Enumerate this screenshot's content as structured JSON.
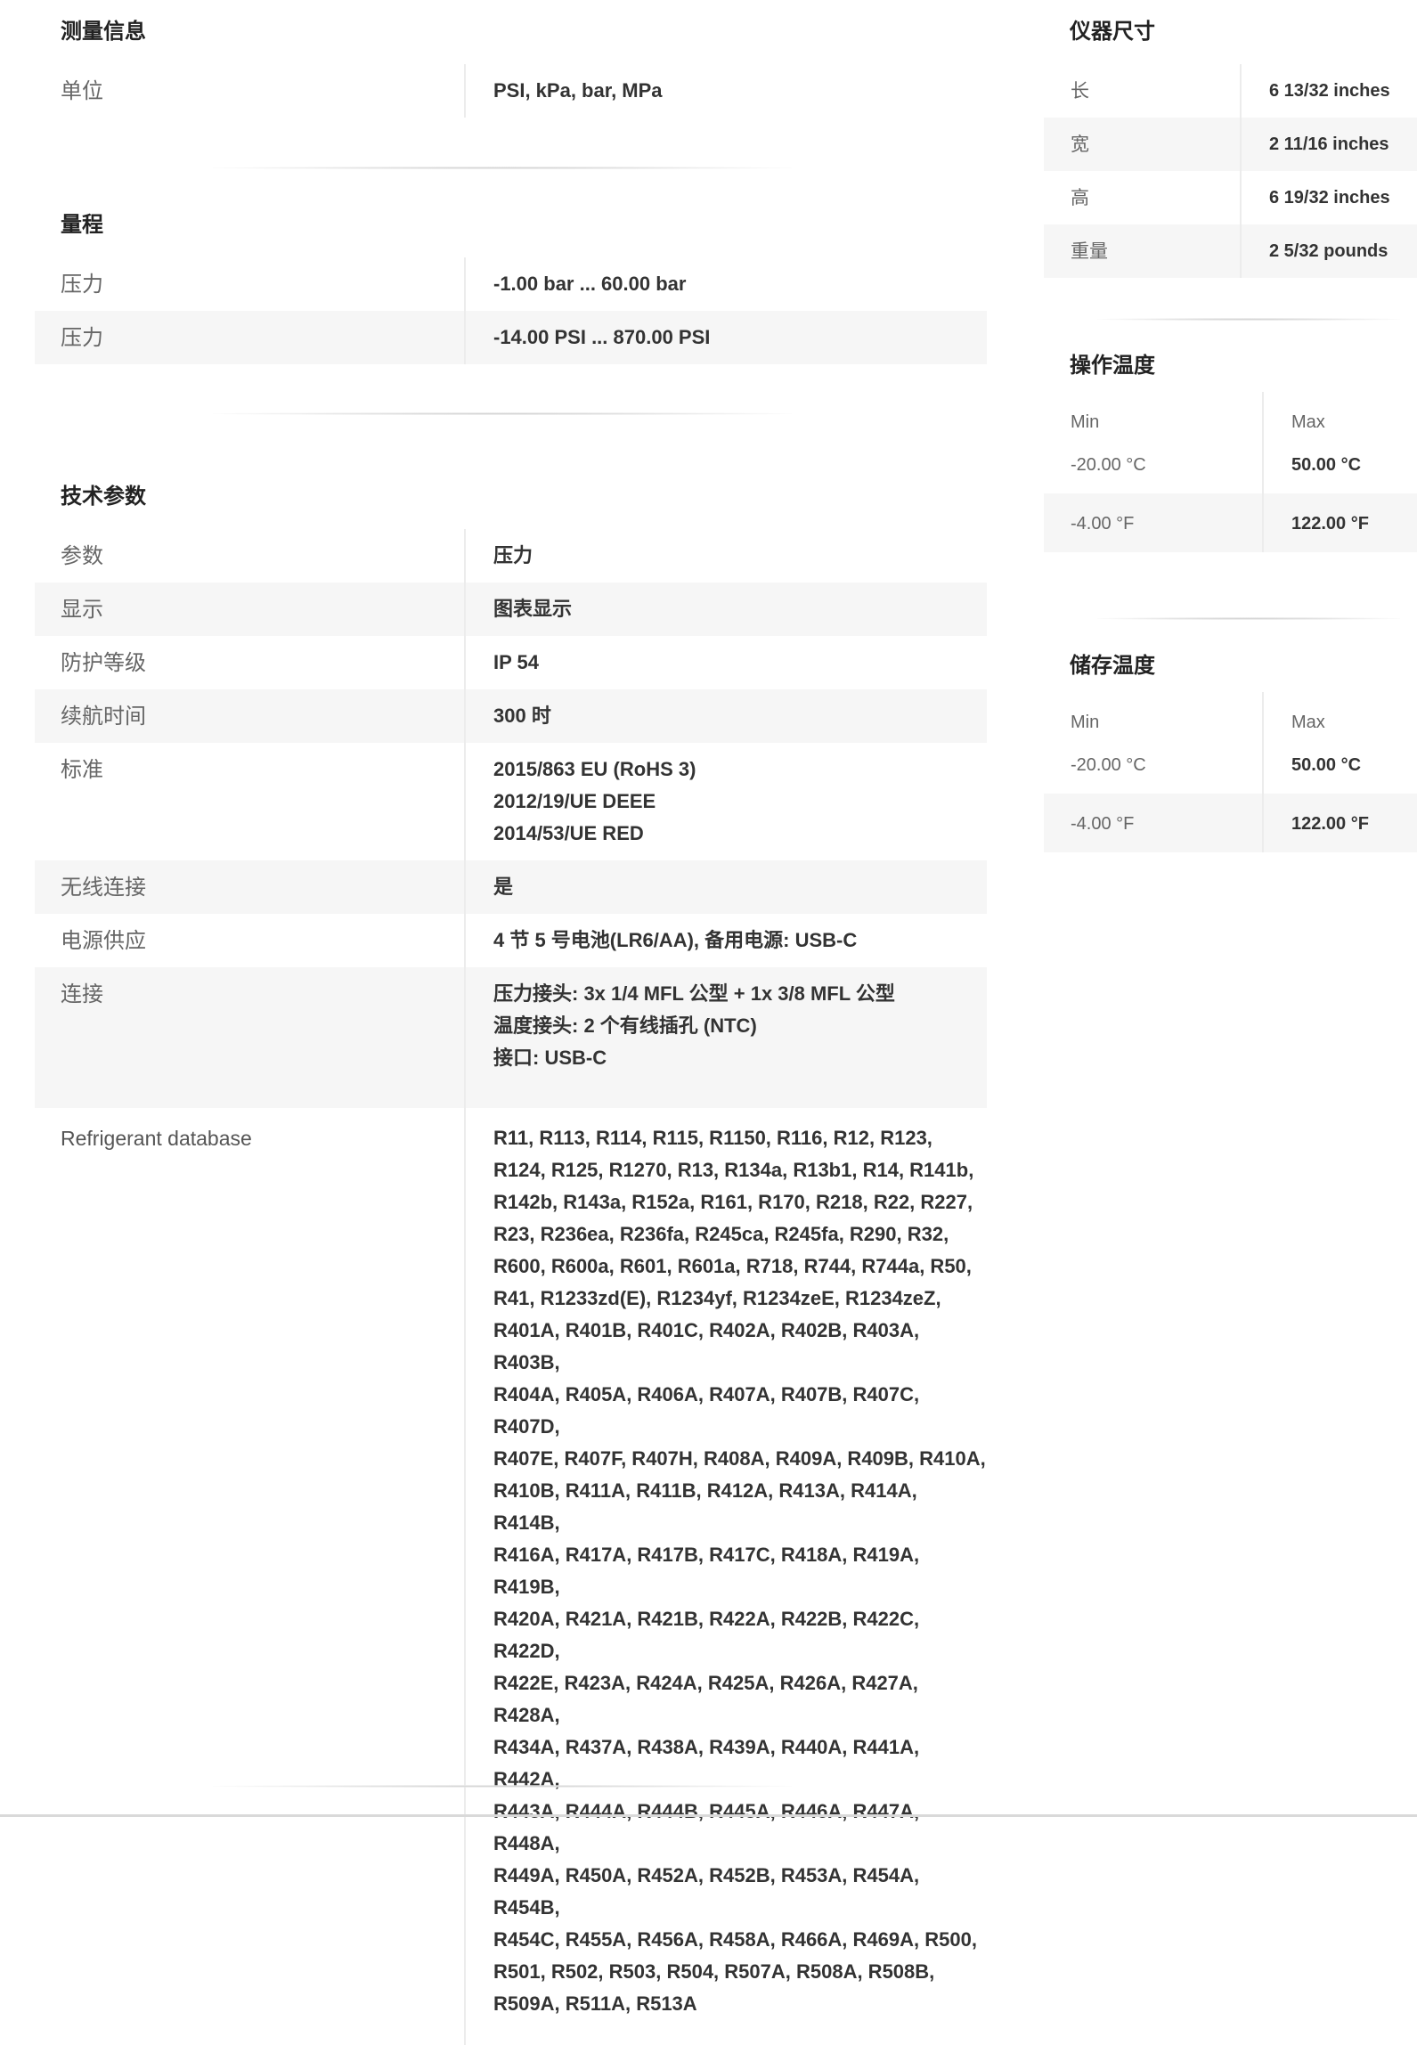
{
  "measurement": {
    "title": "测量信息",
    "rows": [
      {
        "label": "单位",
        "value": "PSI, kPa, bar, MPa"
      }
    ]
  },
  "range": {
    "title": "量程",
    "rows": [
      {
        "label": "压力",
        "value": "-1.00 bar ... 60.00 bar"
      },
      {
        "label": "压力",
        "value": "-14.00 PSI ... 870.00 PSI"
      }
    ]
  },
  "tech": {
    "title": "技术参数",
    "rows": [
      {
        "label": "参数",
        "value": "压力"
      },
      {
        "label": "显示",
        "value": "图表显示"
      },
      {
        "label": "防护等级",
        "value": "IP 54"
      },
      {
        "label": "续航时间",
        "value": "300 时"
      }
    ],
    "standard": {
      "label": "标准",
      "lines": [
        "2015/863 EU (RoHS 3)",
        "2012/19/UE DEEE",
        "2014/53/UE RED"
      ]
    },
    "wireless": {
      "label": "无线连接",
      "value": "是"
    },
    "power": {
      "label": "电源供应",
      "value": "4 节 5 号电池(LR6/AA), 备用电源: USB-C"
    },
    "connection": {
      "label": "连接",
      "lines": [
        "压力接头: 3x 1/4 MFL 公型 + 1x 3/8 MFL 公型",
        "温度接头: 2 个有线插孔 (NTC)",
        "接口: USB-C"
      ]
    },
    "refrigerant": {
      "label": "Refrigerant database",
      "lines": [
        "R11, R113, R114, R115, R1150, R116, R12, R123,",
        "R124, R125, R1270, R13, R134a, R13b1, R14, R141b,",
        "R142b, R143a, R152a, R161, R170, R218, R22, R227,",
        "R23, R236ea, R236fa, R245ca, R245fa, R290, R32,",
        "R600, R600a, R601, R601a, R718, R744, R744a, R50,",
        "R41, R1233zd(E), R1234yf, R1234zeE, R1234zeZ,",
        "R401A, R401B, R401C, R402A, R402B, R403A, R403B,",
        "R404A, R405A, R406A, R407A, R407B, R407C, R407D,",
        "R407E, R407F, R407H, R408A, R409A, R409B, R410A,",
        "R410B, R411A, R411B, R412A, R413A, R414A, R414B,",
        "R416A, R417A, R417B, R417C, R418A, R419A, R419B,",
        "R420A, R421A, R421B, R422A, R422B, R422C, R422D,",
        "R422E, R423A, R424A, R425A, R426A, R427A, R428A,",
        "R434A, R437A, R438A, R439A, R440A, R441A, R442A,",
        "R443A, R444A, R444B, R445A, R446A, R447A, R448A,",
        "R449A, R450A, R452A, R452B, R453A, R454A, R454B,",
        "R454C, R455A, R456A, R458A, R466A, R469A, R500,",
        "R501, R502, R503, R504, R507A, R508A, R508B,",
        "R509A, R511A, R513A"
      ]
    }
  },
  "dimensions": {
    "title": "仪器尺寸",
    "rows": [
      {
        "label": "长",
        "value": "6 13/32 inches"
      },
      {
        "label": "宽",
        "value": "2 11/16 inches"
      },
      {
        "label": "高",
        "value": "6 19/32 inches"
      },
      {
        "label": "重量",
        "value": "2 5/32 pounds"
      }
    ]
  },
  "operating_temp": {
    "title": "操作温度",
    "head": {
      "min": "Min",
      "max": "Max"
    },
    "rows": [
      {
        "min": "-20.00 °C",
        "max": "50.00 °C"
      },
      {
        "min": "-4.00 °F",
        "max": "122.00 °F"
      }
    ]
  },
  "storage_temp": {
    "title": "储存温度",
    "head": {
      "min": "Min",
      "max": "Max"
    },
    "rows": [
      {
        "min": "-20.00 °C",
        "max": "50.00 °C"
      },
      {
        "min": "-4.00 °F",
        "max": "122.00 °F"
      }
    ]
  }
}
